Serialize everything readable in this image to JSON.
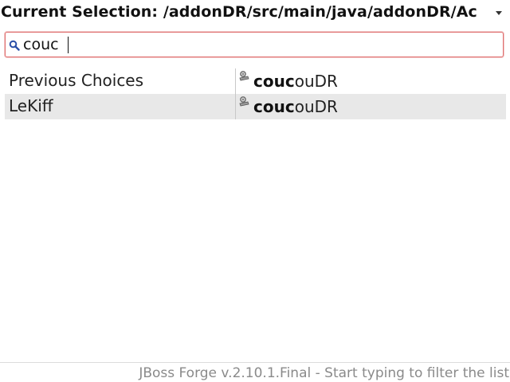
{
  "header": {
    "title": "Current Selection: /addonDR/src/main/java/addonDR/Ac",
    "dropdown_icon": "chevron-down-icon"
  },
  "search": {
    "value": "couc",
    "icon": "search-icon"
  },
  "results": [
    {
      "category": "Previous Choices",
      "command_match": "couc",
      "command_rest": "ouDR",
      "icon": "forge-command-icon",
      "selected": false
    },
    {
      "category": "LeKiff",
      "command_match": "couc",
      "command_rest": "ouDR",
      "icon": "forge-command-icon",
      "selected": true
    }
  ],
  "footer": {
    "status": "JBoss Forge v.2.10.1.Final - Start typing to filter the list"
  },
  "colors": {
    "search_border": "#e07070",
    "selected_row": "#e8e8e8",
    "footer_text": "#8a8a8a"
  }
}
